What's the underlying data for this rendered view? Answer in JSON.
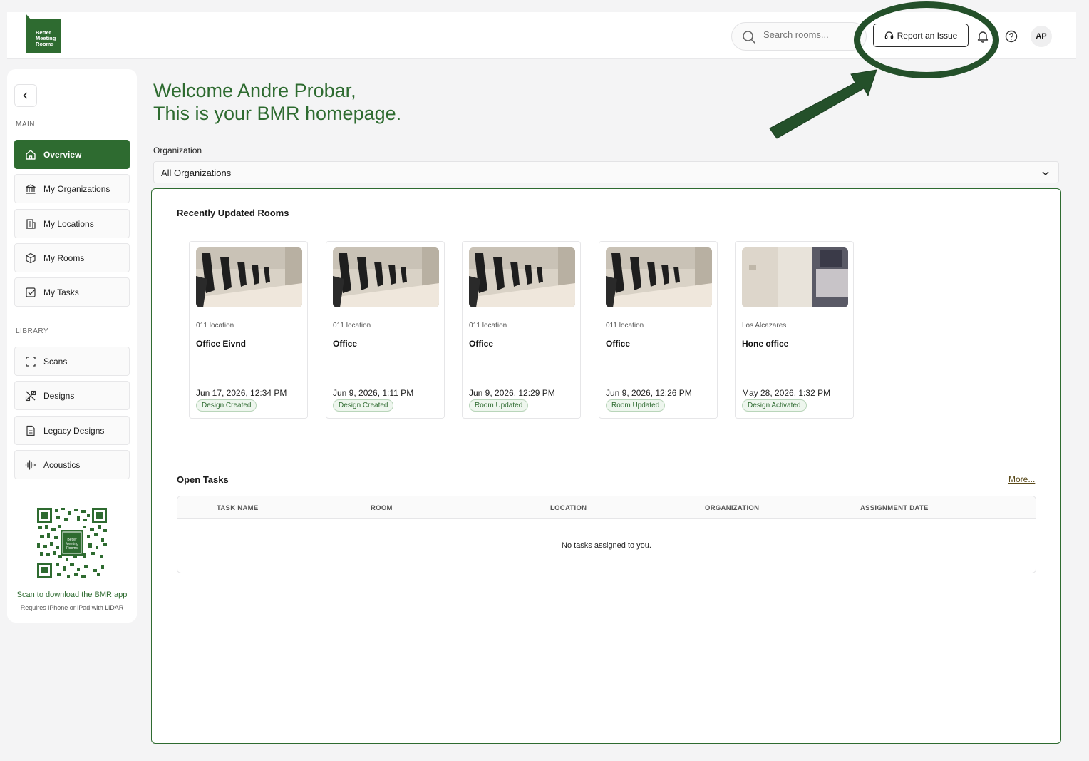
{
  "header": {
    "logo_text": "Better Meeting Rooms",
    "search_placeholder": "Search rooms...",
    "report_button": "Report an Issue",
    "avatar_initials": "AP"
  },
  "sidebar": {
    "main_label": "MAIN",
    "main_items": [
      {
        "label": "Overview",
        "icon": "home-icon",
        "active": true
      },
      {
        "label": "My Organizations",
        "icon": "bank-icon"
      },
      {
        "label": "My Locations",
        "icon": "building-icon"
      },
      {
        "label": "My Rooms",
        "icon": "cube-icon"
      },
      {
        "label": "My Tasks",
        "icon": "checkbox-icon"
      }
    ],
    "library_label": "LIBRARY",
    "library_items": [
      {
        "label": "Scans",
        "icon": "scan-icon"
      },
      {
        "label": "Designs",
        "icon": "design-icon"
      },
      {
        "label": "Legacy Designs",
        "icon": "document-icon"
      },
      {
        "label": "Acoustics",
        "icon": "waveform-icon"
      }
    ],
    "qr_caption": "Scan to download the BMR app",
    "qr_subcaption": "Requires iPhone or iPad with LiDAR"
  },
  "main": {
    "welcome_line1": "Welcome Andre Probar,",
    "welcome_line2": "This is your BMR homepage.",
    "org_label": "Organization",
    "org_value": "All Organizations",
    "recent_title": "Recently Updated Rooms",
    "rooms": [
      {
        "location": "011 location",
        "name": "Office Eivnd",
        "date": "Jun 17, 2026, 12:34 PM",
        "badge": "Design Created"
      },
      {
        "location": "011 location",
        "name": "Office",
        "date": "Jun 9, 2026, 1:11 PM",
        "badge": "Design Created"
      },
      {
        "location": "011 location",
        "name": "Office",
        "date": "Jun 9, 2026, 12:29 PM",
        "badge": "Room Updated"
      },
      {
        "location": "011 location",
        "name": "Office",
        "date": "Jun 9, 2026, 12:26 PM",
        "badge": "Room Updated"
      },
      {
        "location": "Los Alcazares",
        "name": "Hone office",
        "date": "May 28, 2026, 1:32 PM",
        "badge": "Design Activated"
      }
    ],
    "tasks_title": "Open Tasks",
    "more_link": "More...",
    "task_columns": [
      "TASK NAME",
      "ROOM",
      "LOCATION",
      "ORGANIZATION",
      "ASSIGNMENT DATE"
    ],
    "empty_message": "No tasks assigned to you."
  },
  "colors": {
    "brand": "#2e6b30",
    "annotation": "#24502a"
  }
}
